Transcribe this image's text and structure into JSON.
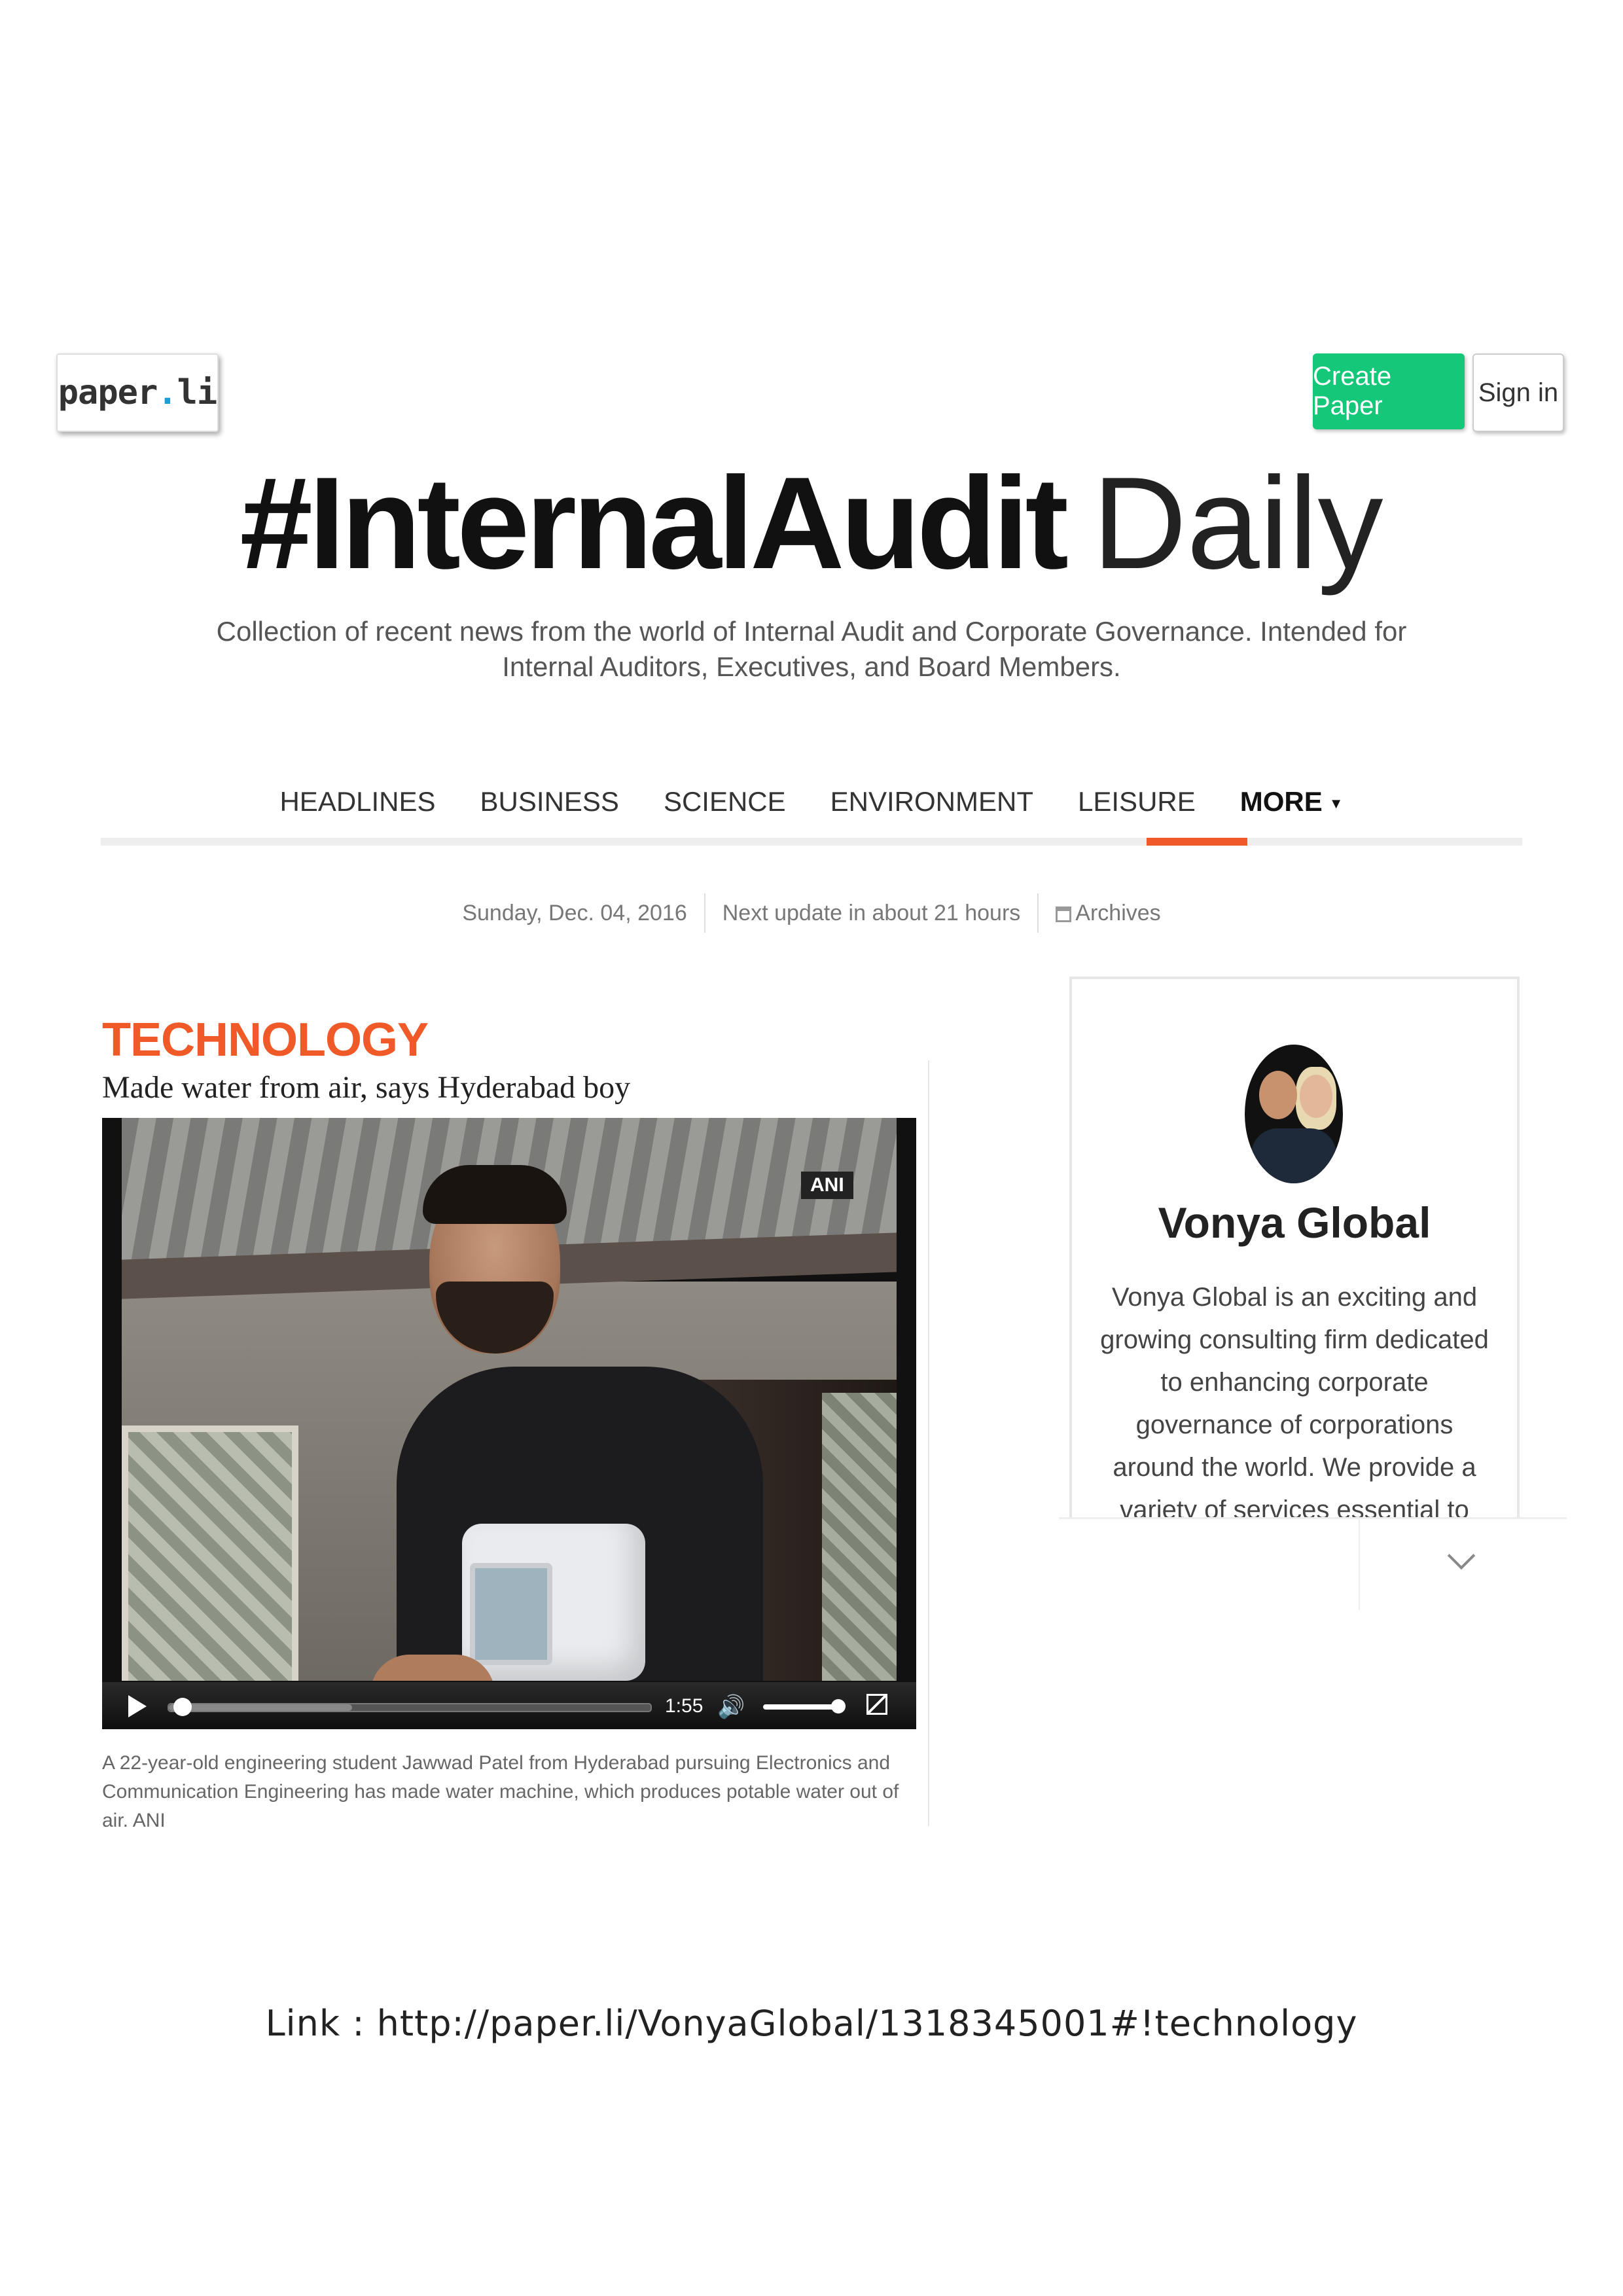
{
  "header": {
    "logo_text_left": "paper",
    "logo_text_dot": ".",
    "logo_text_right": "li",
    "create_paper_label": "Create Paper",
    "sign_in_label": "Sign in"
  },
  "masthead": {
    "title_bold": "#InternalAudit",
    "title_thin": "Daily",
    "tagline": "Collection of recent news from the world of Internal Audit and Corporate Governance. Intended for Internal Auditors, Executives, and Board Members."
  },
  "nav": {
    "items": [
      "HEADLINES",
      "BUSINESS",
      "SCIENCE",
      "ENVIRONMENT",
      "LEISURE"
    ],
    "more_label": "MORE",
    "active": "MORE"
  },
  "info_bar": {
    "date": "Sunday, Dec. 04, 2016",
    "next_update": "Next update in about 21 hours",
    "archives": "Archives"
  },
  "article": {
    "section": "TECHNOLOGY",
    "title": "Made water from air, says Hyderabad boy",
    "video": {
      "badge": "ANI",
      "time": "1:55",
      "progress": 0.01,
      "buffered": 0.38,
      "volume": 0.9
    },
    "caption": "A 22-year-old engineering student Jawwad Patel from Hyderabad pursuing Electronics and Communication Engineering has made water machine, which produces potable water out of air. ANI"
  },
  "sidebar": {
    "name": "Vonya Global",
    "description": "Vonya Global is an exciting and growing consulting firm dedicated to enhancing corporate governance of corporations around the world. We provide a variety of services essential to helping organizations gain confidence that risk is"
  },
  "footer": {
    "link_text": "Link : http://paper.li/VonyaGlobal/1318345001#!technology"
  },
  "colors": {
    "accent": "#f05a28",
    "create_button": "#15c879",
    "logo_dot": "#1aa0d8"
  }
}
